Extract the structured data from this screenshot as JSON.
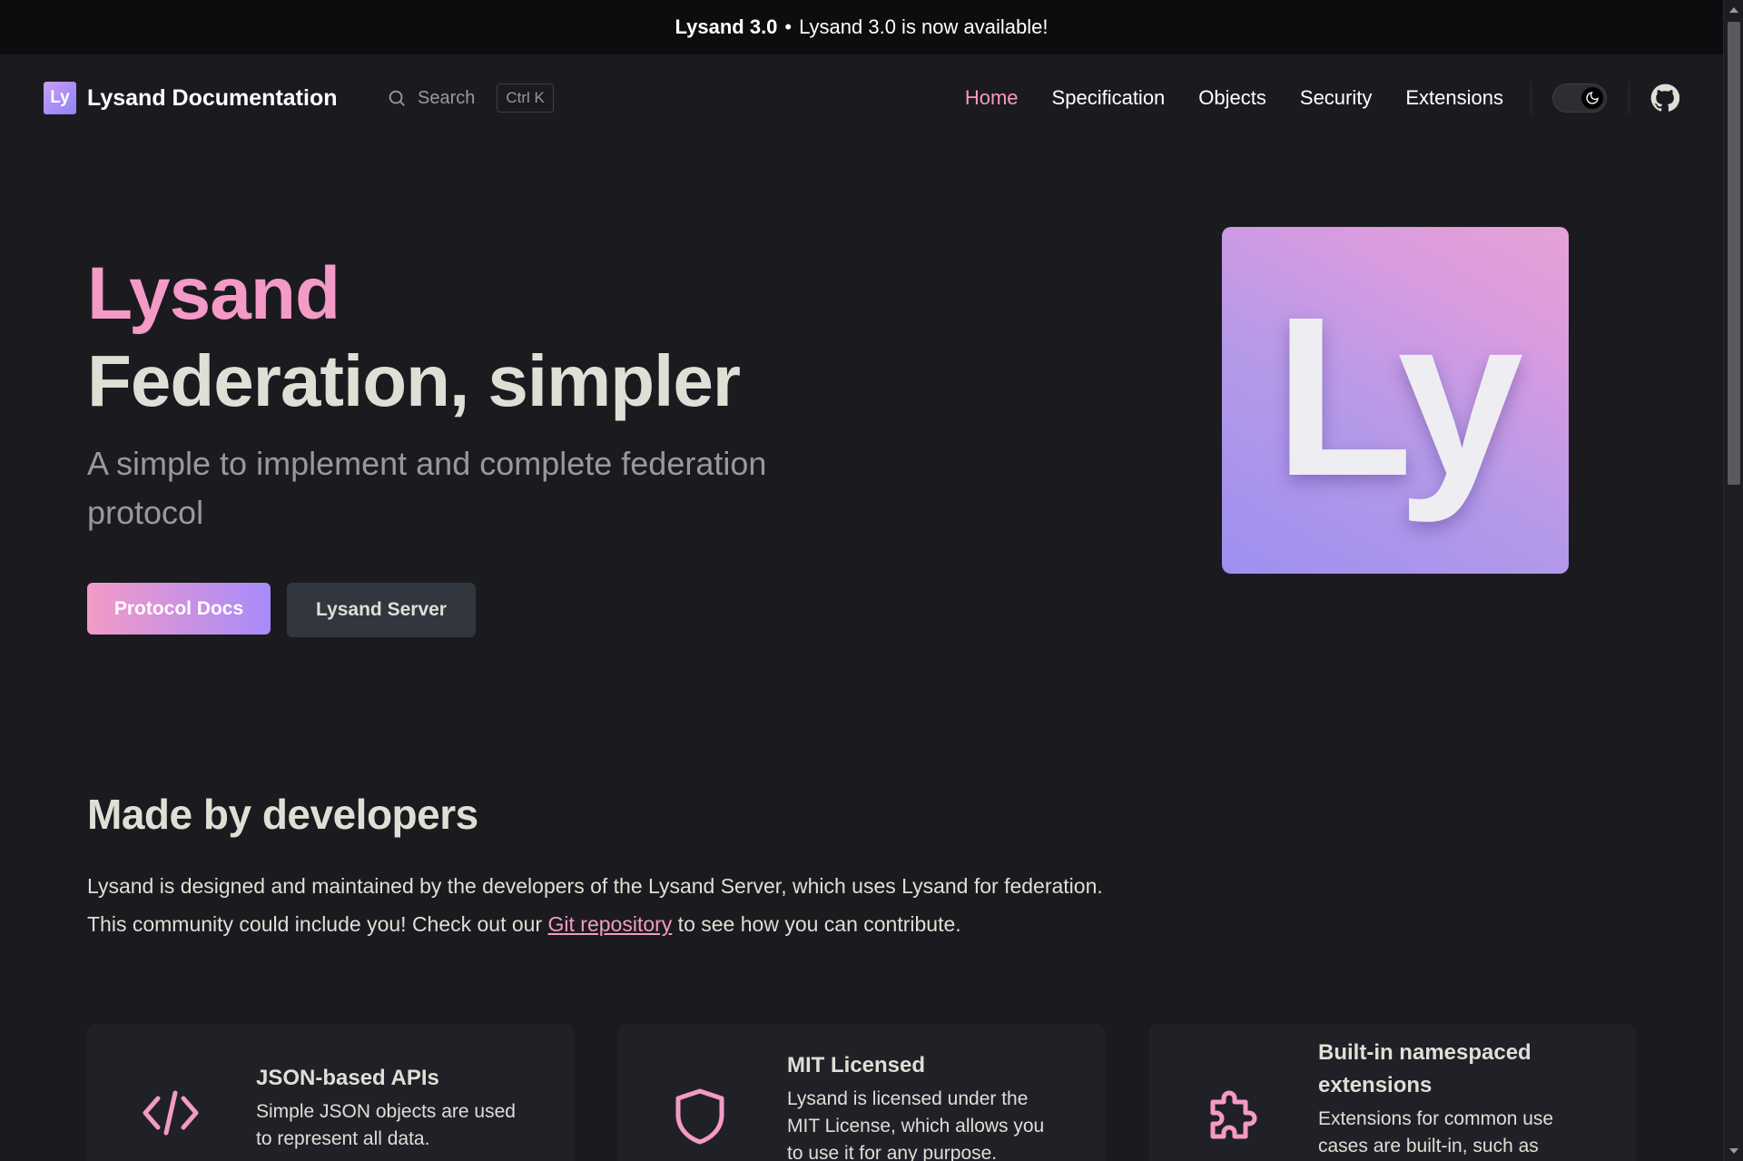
{
  "banner": {
    "version": "Lysand 3.0",
    "separator": "•",
    "message": "Lysand 3.0 is now available!"
  },
  "nav": {
    "logo_text": "Ly",
    "title": "Lysand Documentation",
    "search_label": "Search",
    "search_shortcut": "Ctrl K",
    "links": [
      {
        "label": "Home",
        "active": true
      },
      {
        "label": "Specification",
        "active": false
      },
      {
        "label": "Objects",
        "active": false
      },
      {
        "label": "Security",
        "active": false
      },
      {
        "label": "Extensions",
        "active": false
      }
    ],
    "theme_icon": "moon-icon",
    "github_icon": "github-icon"
  },
  "hero": {
    "name": "Lysand",
    "text": "Federation, simpler",
    "tagline": "A simple to implement and complete federation protocol",
    "primary_button": "Protocol Docs",
    "secondary_button": "Lysand Server",
    "image_text": "Ly"
  },
  "section": {
    "title": "Made by developers",
    "body_before": "Lysand is designed and maintained by the developers of the Lysand Server, which uses Lysand for federation. This community could include you! Check out our ",
    "link_text": "Git repository",
    "body_after": " to see how you can contribute."
  },
  "features": [
    {
      "icon": "code-icon",
      "title": "JSON-based APIs",
      "text": "Simple JSON objects are used to represent all data."
    },
    {
      "icon": "shield-icon",
      "title": "MIT Licensed",
      "text": "Lysand is licensed under the MIT License, which allows you to use it for any purpose."
    },
    {
      "icon": "puzzle-icon",
      "title": "Built-in namespaced extensions",
      "text": "Extensions for common use cases are built-in, such as"
    }
  ],
  "colors": {
    "accent": "#f49ac6",
    "accent2": "#a78bfa",
    "background": "#1b1b1f",
    "card": "#202127"
  }
}
